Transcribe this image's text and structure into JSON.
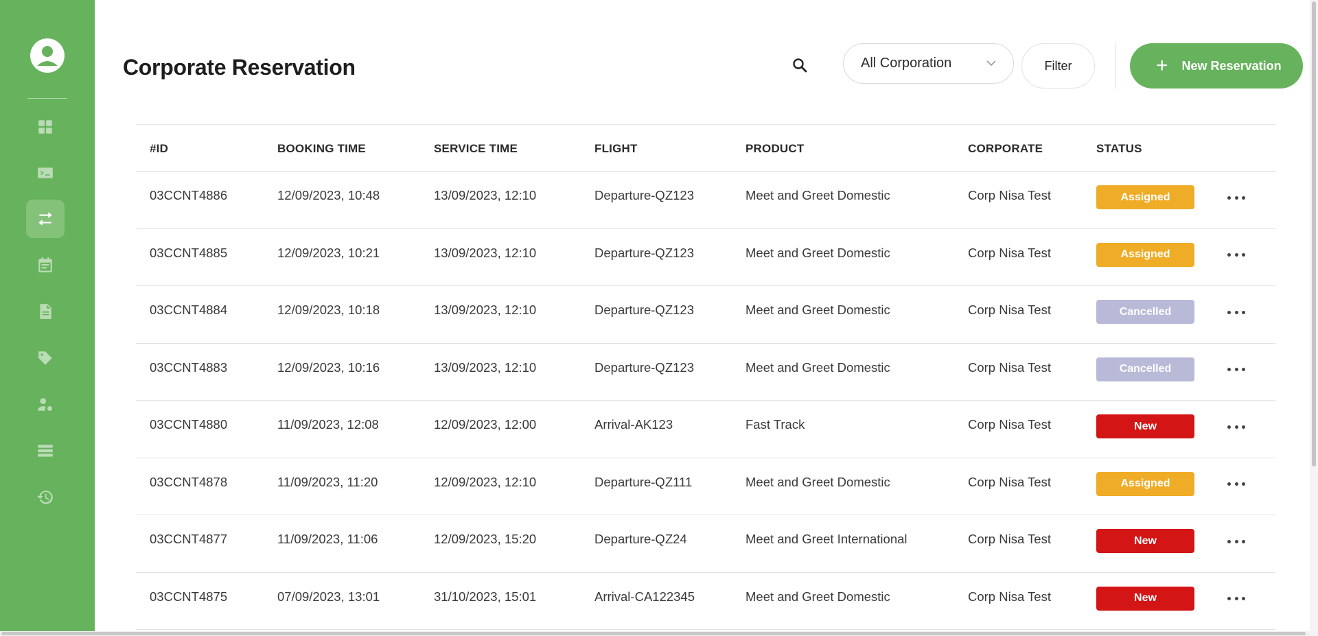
{
  "page": {
    "title": "Corporate Reservation"
  },
  "colors": {
    "brand": "#67b25c",
    "assigned": "#efac26",
    "cancelled": "#b9b9d8",
    "new": "#d31515"
  },
  "toolbar": {
    "search_icon": "search-icon",
    "corporation_select": "All Corporation",
    "filter_label": "Filter",
    "new_reservation_label": "New Reservation"
  },
  "sidebar": {
    "items": [
      {
        "icon": "dashboard-icon"
      },
      {
        "icon": "terminal-icon"
      },
      {
        "icon": "transfer-icon",
        "active": true
      },
      {
        "icon": "calendar-icon"
      },
      {
        "icon": "document-icon"
      },
      {
        "icon": "tag-icon"
      },
      {
        "icon": "user-settings-icon"
      },
      {
        "icon": "list-icon"
      },
      {
        "icon": "history-icon"
      }
    ]
  },
  "table": {
    "headers": {
      "id": "#ID",
      "booking_time": "BOOKING TIME",
      "service_time": "SERVICE TIME",
      "flight": "FLIGHT",
      "product": "PRODUCT",
      "corporate": "CORPORATE",
      "status": "STATUS"
    },
    "rows": [
      {
        "id": "03CCNT4886",
        "booking_time": "12/09/2023, 10:48",
        "service_time": "13/09/2023, 12:10",
        "flight": "Departure-QZ123",
        "product": "Meet and Greet Domestic",
        "corporate": "Corp Nisa Test",
        "status": "Assigned"
      },
      {
        "id": "03CCNT4885",
        "booking_time": "12/09/2023, 10:21",
        "service_time": "13/09/2023, 12:10",
        "flight": "Departure-QZ123",
        "product": "Meet and Greet Domestic",
        "corporate": "Corp Nisa Test",
        "status": "Assigned"
      },
      {
        "id": "03CCNT4884",
        "booking_time": "12/09/2023, 10:18",
        "service_time": "13/09/2023, 12:10",
        "flight": "Departure-QZ123",
        "product": "Meet and Greet Domestic",
        "corporate": "Corp Nisa Test",
        "status": "Cancelled"
      },
      {
        "id": "03CCNT4883",
        "booking_time": "12/09/2023, 10:16",
        "service_time": "13/09/2023, 12:10",
        "flight": "Departure-QZ123",
        "product": "Meet and Greet Domestic",
        "corporate": "Corp Nisa Test",
        "status": "Cancelled"
      },
      {
        "id": "03CCNT4880",
        "booking_time": "11/09/2023, 12:08",
        "service_time": "12/09/2023, 12:00",
        "flight": "Arrival-AK123",
        "product": "Fast Track",
        "corporate": "Corp Nisa Test",
        "status": "New"
      },
      {
        "id": "03CCNT4878",
        "booking_time": "11/09/2023, 11:20",
        "service_time": "12/09/2023, 12:10",
        "flight": "Departure-QZ111",
        "product": "Meet and Greet Domestic",
        "corporate": "Corp Nisa Test",
        "status": "Assigned"
      },
      {
        "id": "03CCNT4877",
        "booking_time": "11/09/2023, 11:06",
        "service_time": "12/09/2023, 15:20",
        "flight": "Departure-QZ24",
        "product": "Meet and Greet International",
        "corporate": "Corp Nisa Test",
        "status": "New"
      },
      {
        "id": "03CCNT4875",
        "booking_time": "07/09/2023, 13:01",
        "service_time": "31/10/2023, 15:01",
        "flight": "Arrival-CA122345",
        "product": "Meet and Greet Domestic",
        "corporate": "Corp Nisa Test",
        "status": "New"
      }
    ]
  }
}
